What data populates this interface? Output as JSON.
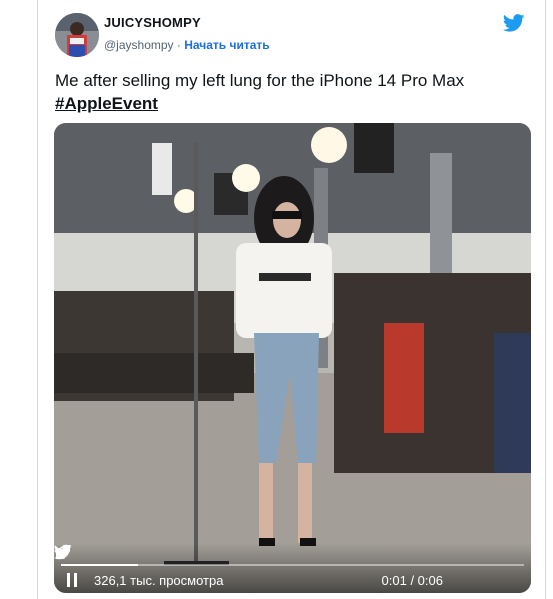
{
  "tweet": {
    "display_name": "JUICYSHOMPY",
    "handle": "@jayshompy",
    "separator": "·",
    "follow_label": "Начать читать",
    "text": "Me after selling my left lung for the iPhone 14 Pro Max",
    "hashtag": "#AppleEvent"
  },
  "video": {
    "views": "326,1 тыс. просмотра",
    "time": "0:01 / 0:06",
    "progress": 0.167,
    "controls_icons": [
      "pause-icon",
      "volume-icon",
      "twitter-bird-icon",
      "fullscreen-icon"
    ]
  },
  "colors": {
    "link": "#1d6ee0",
    "twitter_blue": "#1d9bf0",
    "text": "#0f1419",
    "muted": "#536471"
  }
}
